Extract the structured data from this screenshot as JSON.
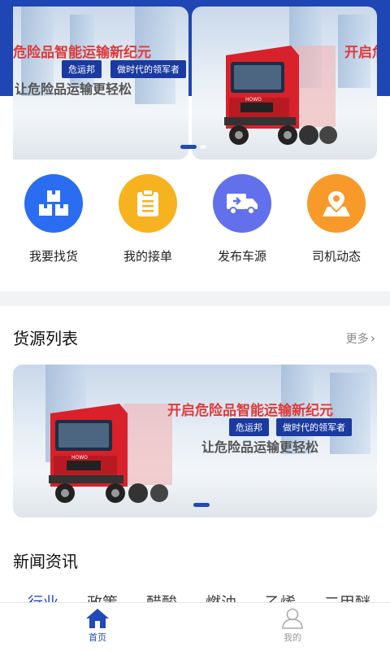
{
  "banner": {
    "headline": "开启危险品智能运输新纪元",
    "headline_partial_left": "危险品智能运输新纪元",
    "headline_partial_right": "开启危",
    "tag1": "危运邦",
    "tag2": "做时代的领军者",
    "subline": "让危险品运输更轻松",
    "subline_partial": "让危险品运输更轻松",
    "truck_brand": "HOWO"
  },
  "menu": [
    {
      "label": "我要找货",
      "icon": "boxes-icon",
      "color": "#2a6df0"
    },
    {
      "label": "我的接单",
      "icon": "clipboard-icon",
      "color": "#f7b21f"
    },
    {
      "label": "发布车源",
      "icon": "truck-icon",
      "color": "#6270ec"
    },
    {
      "label": "司机动态",
      "icon": "map-pin-icon",
      "color": "#f79a2a"
    }
  ],
  "cargo": {
    "title": "货源列表",
    "more": "更多",
    "more_arrow": "›"
  },
  "news": {
    "title": "新闻资讯",
    "tabs": [
      "行业",
      "政策",
      "醋酸",
      "燃油",
      "乙烯",
      "二甲醚"
    ]
  },
  "nav": {
    "home": "首页",
    "mine": "我的"
  },
  "colors": {
    "brand_blue": "#1f4ab8",
    "banner_red": "#e03a3a"
  }
}
